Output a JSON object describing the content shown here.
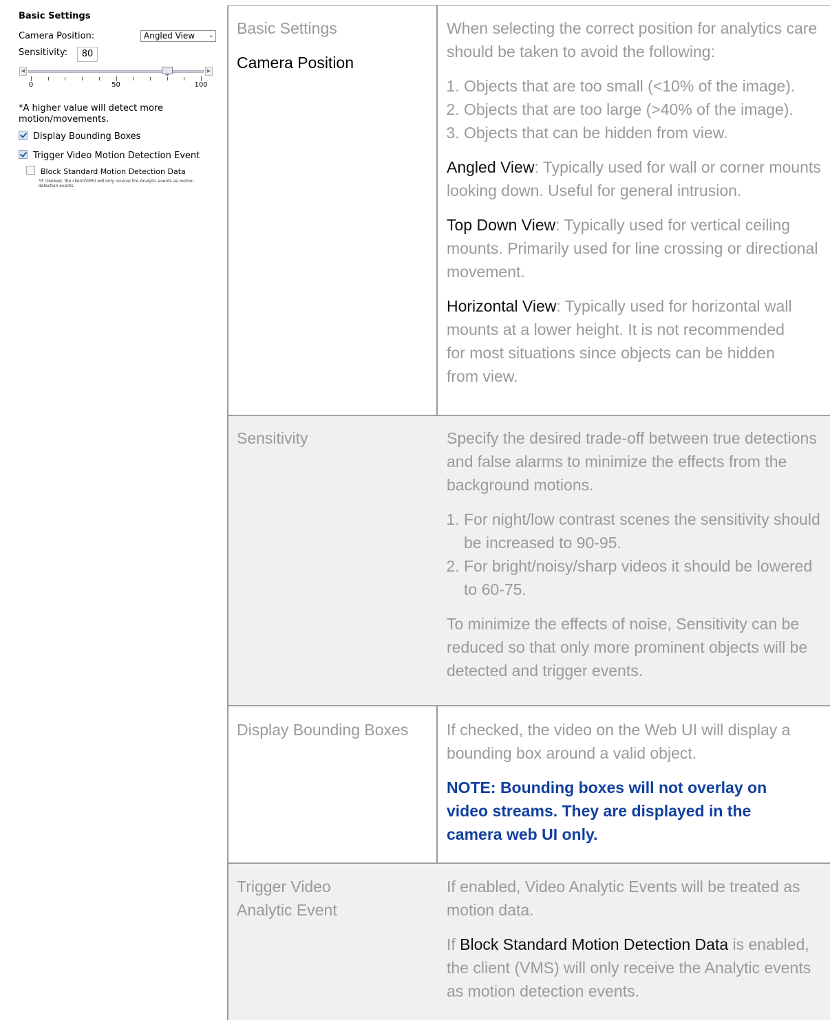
{
  "panel": {
    "title": "Basic Settings",
    "camera_position_label": "Camera Position:",
    "camera_position_value": "Angled View",
    "sensitivity_label": "Sensitivity:",
    "sensitivity_value": "80",
    "slider": {
      "min": 0,
      "max": 100,
      "value": 80,
      "tick_labels": [
        "0",
        "50",
        "100"
      ]
    },
    "note": "*A higher value will detect more motion/movements.",
    "checkboxes": [
      {
        "label": "Display Bounding Boxes",
        "checked": true
      },
      {
        "label": "Trigger Video Motion Detection Event",
        "checked": true
      },
      {
        "label": "Block Standard Motion Detection Data",
        "checked": false
      }
    ],
    "block_note": "*If checked, the client(VMS) will only receive the Analytic events as motion detection events."
  },
  "table": {
    "row1": {
      "left_title": "Basic Settings",
      "left_subtitle": "Camera Position",
      "intro": "When selecting the correct position for analytics care should be taken to avoid the following:",
      "items": [
        "Objects that are too small (<10% of the image).",
        "Objects that are too large (>40% of the image).",
        "Objects that can be hidden from view."
      ],
      "angled_term": "Angled View",
      "angled_text": ": Typically used for wall or corner mounts looking down. Useful for general intrusion.",
      "topdown_term": "Top Down View",
      "topdown_text": ": Typically used for vertical ceiling mounts. Primarily used for line crossing or directional movement.",
      "horizontal_term": "Horizontal View",
      "horizontal_text": ": Typically used for horizontal wall mounts at a lower height. It is not recommended for most situations since objects can be hidden from view."
    },
    "row2": {
      "left": "Sensitivity",
      "intro": "Specify the desired trade-off between true detections and false alarms to minimize the effects from the background motions.",
      "items": [
        "For night/low contrast scenes the sensitivity should be increased to 90-95.",
        "For bright/noisy/sharp videos it should be lowered to 60-75."
      ],
      "outro": "To minimize the effects of noise, Sensitivity can be reduced so that only more prominent objects will be detected and trigger events."
    },
    "row3": {
      "left": "Display Bounding Boxes",
      "text": "If checked, the video on the Web UI will display a bounding box around a valid object.",
      "note": "NOTE: Bounding boxes will not overlay on video streams. They are displayed in the camera web UI only."
    },
    "row4": {
      "left_line1": "Trigger Video",
      "left_line2": "Analytic Event",
      "text1": "If enabled, Video Analytic Events will be treated as motion data.",
      "text2_pre": "If ",
      "text2_term": "Block Standard Motion Detection Data",
      "text2_post": " is enabled, the client (VMS) will only receive the Analytic events as motion detection events."
    }
  }
}
